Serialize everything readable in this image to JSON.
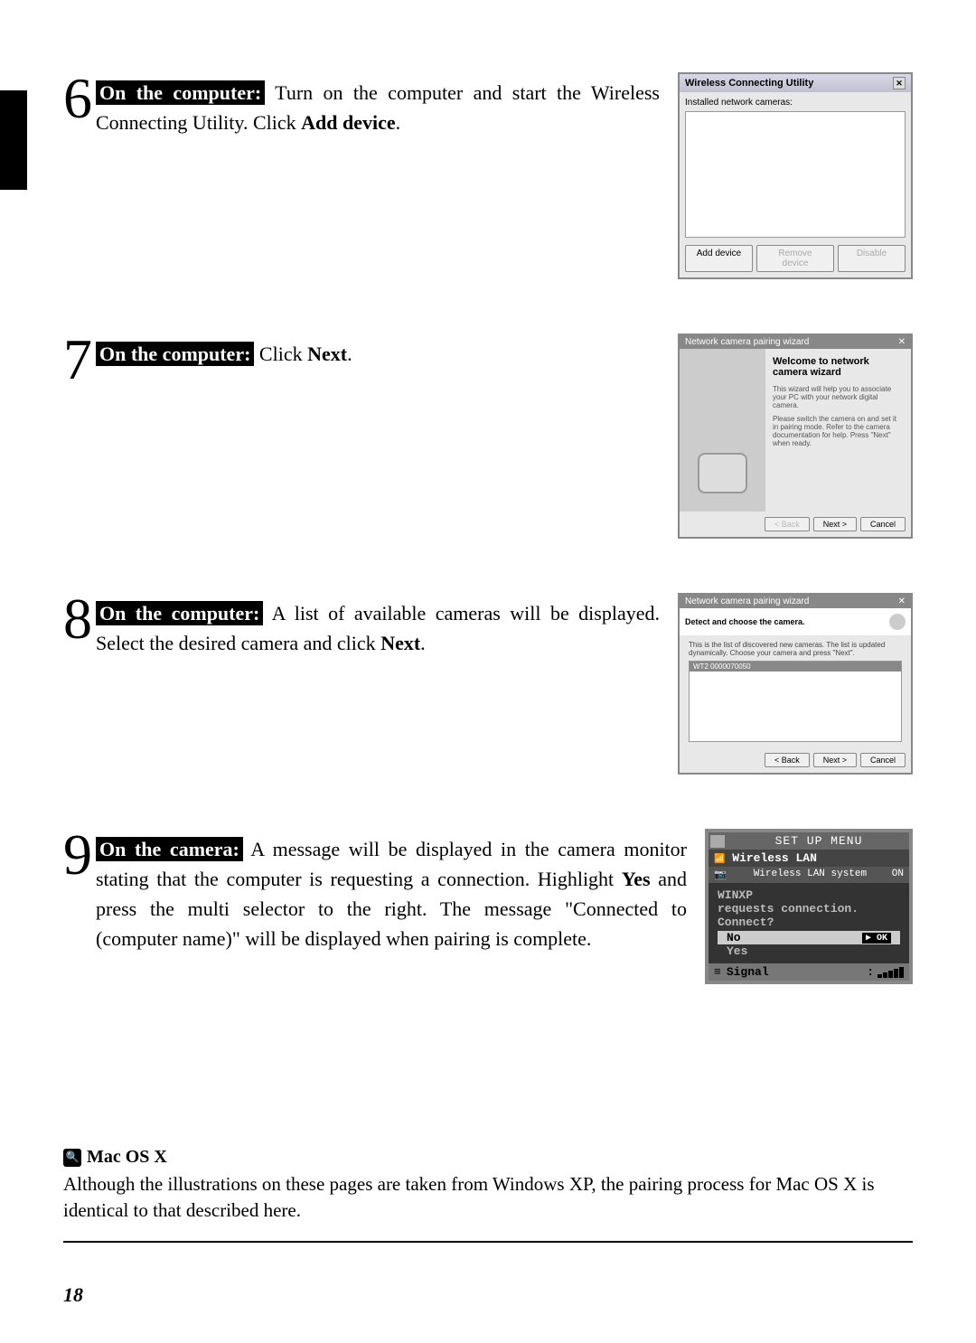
{
  "steps": {
    "6": {
      "number": "6",
      "label": "On the computer:",
      "text_before": " Turn on the computer and start the Wireless Connecting Utility. Click ",
      "bold1": "Add device",
      "text_after": "."
    },
    "7": {
      "number": "7",
      "label": "On the computer:",
      "text_before": " Click ",
      "bold1": "Next",
      "text_after": "."
    },
    "8": {
      "number": "8",
      "label": "On the computer:",
      "text_before": " A list of available cameras will be displayed. Select the desired camera and click ",
      "bold1": "Next",
      "text_after": "."
    },
    "9": {
      "number": "9",
      "label": "On the camera:",
      "text_before": " A message will be displayed in the camera monitor stating that the computer is requesting a connection. Highlight ",
      "bold1": "Yes",
      "text_mid": " and press the multi selector to the right. The message \"Connected to (computer name)\" will be displayed when pairing is complete."
    }
  },
  "dialog1": {
    "title": "Wireless Connecting Utility",
    "label": "Installed network cameras:",
    "btn_add": "Add device",
    "btn_remove": "Remove device",
    "btn_disable": "Disable"
  },
  "wizard": {
    "title": "Network camera pairing wizard",
    "welcome": "Welcome to network camera wizard",
    "desc1": "This wizard will help you to associate your PC with your network digital camera.",
    "desc2": "Please switch the camera on and set it in pairing mode. Refer to the camera documentation for help. Press \"Next\" when ready.",
    "btn_back": "< Back",
    "btn_next": "Next >",
    "btn_cancel": "Cancel"
  },
  "detect": {
    "title": "Network camera pairing wizard",
    "subhead": "Detect and choose the camera.",
    "desc": "This is the list of discovered new cameras. The list is updated dynamically. Choose your camera and press \"Next\".",
    "item": "WT2 0000070050",
    "btn_back": "< Back",
    "btn_next": "Next >",
    "btn_cancel": "Cancel"
  },
  "camera": {
    "setup": "SET UP MENU",
    "wlan": "Wireless LAN",
    "system_label": "Wireless LAN system",
    "system_val": "ON",
    "host": "WINXP",
    "req": "requests connection.",
    "connect": "Connect?",
    "no": "No",
    "yes": "Yes",
    "ok": "▶ OK",
    "signal": "Signal",
    "colon": ":"
  },
  "note": {
    "title": "Mac OS X",
    "text": "Although the illustrations on these pages are taken from Windows XP, the pairing process for Mac OS X is identical to that described here."
  },
  "page_number": "18"
}
